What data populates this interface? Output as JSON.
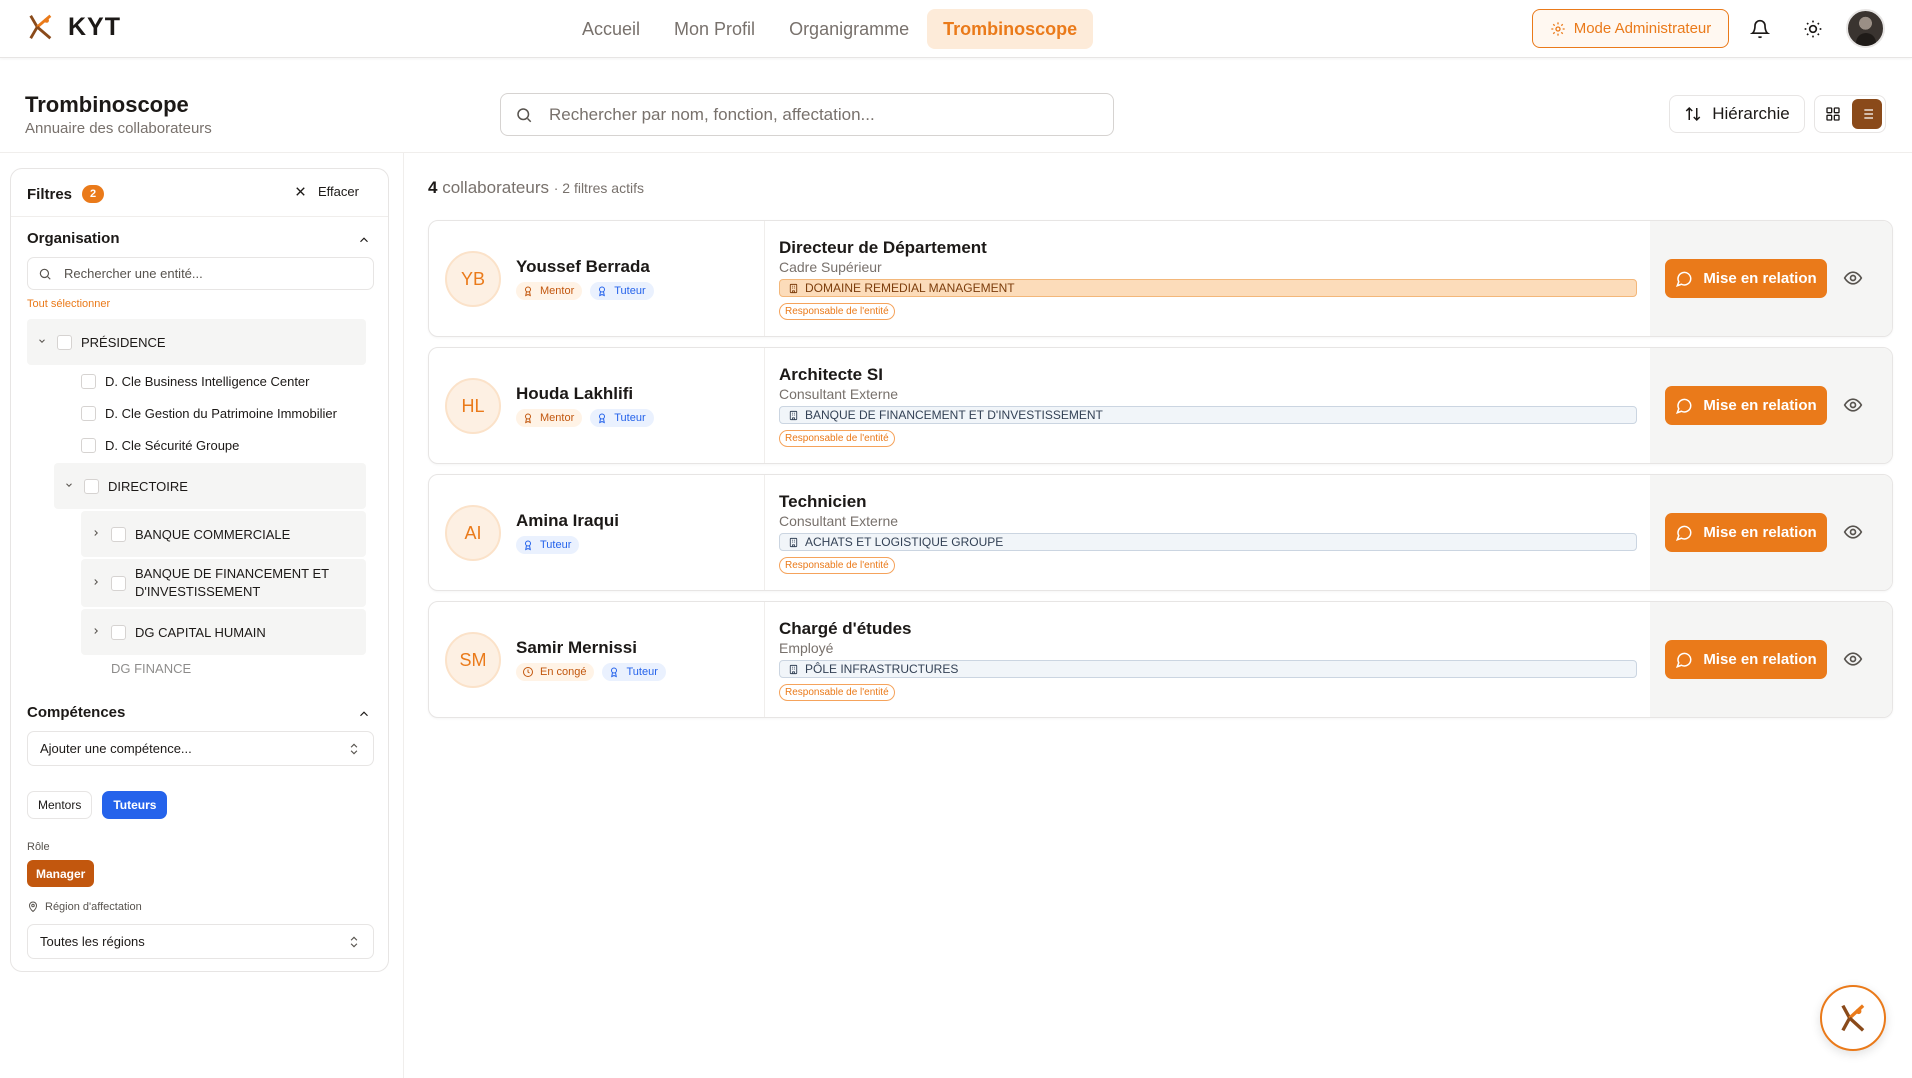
{
  "app": {
    "name": "KYT"
  },
  "nav": {
    "items": [
      {
        "label": "Accueil",
        "active": false
      },
      {
        "label": "Mon Profil",
        "active": false
      },
      {
        "label": "Organigramme",
        "active": false
      },
      {
        "label": "Trombinoscope",
        "active": true
      }
    ]
  },
  "topbar": {
    "admin_label": "Mode Administrateur"
  },
  "page": {
    "title": "Trombinoscope",
    "subtitle": "Annuaire des collaborateurs",
    "search_placeholder": "Rechercher par nom, fonction, affectation...",
    "hierarchy_label": "Hiérarchie"
  },
  "filters": {
    "title": "Filtres",
    "count": "2",
    "clear_label": "Effacer",
    "organisation": {
      "title": "Organisation",
      "search_placeholder": "Rechercher une entité...",
      "select_all": "Tout sélectionner",
      "tree": [
        "PRÉSIDENCE",
        "D. Cle Business Intelligence Center",
        "D. Cle Gestion du Patrimoine Immobilier",
        "D. Cle Sécurité Groupe",
        "DIRECTOIRE",
        "BANQUE COMMERCIALE",
        "BANQUE DE FINANCEMENT ET",
        "D'INVESTISSEMENT",
        "DG CAPITAL HUMAIN",
        "DG FINANCE"
      ]
    },
    "competences": {
      "title": "Compétences",
      "select_placeholder": "Ajouter une compétence...",
      "pills": [
        "Mentors",
        "Tuteurs"
      ]
    },
    "role": {
      "label": "Rôle",
      "value": "Manager"
    },
    "region": {
      "label": "Région d'affectation",
      "value": "Toutes les régions"
    }
  },
  "results": {
    "count": "4",
    "count_label": "collaborateurs",
    "active_filters": "· 2 filtres actifs",
    "contact_label": "Mise en relation",
    "responsable_label": "Responsable de l'entité",
    "cards": [
      {
        "initials": "YB",
        "name": "Youssef Berrada",
        "badges": [
          "Mentor",
          "Tuteur"
        ],
        "role": "Directeur de Département",
        "grade": "Cadre Supérieur",
        "entity": "DOMAINE REMEDIAL MANAGEMENT"
      },
      {
        "initials": "HL",
        "name": "Houda Lakhlifi",
        "badges": [
          "Mentor",
          "Tuteur"
        ],
        "role": "Architecte SI",
        "grade": "Consultant Externe",
        "entity": "BANQUE DE FINANCEMENT ET D'INVESTISSEMENT"
      },
      {
        "initials": "AI",
        "name": "Amina Iraqui",
        "badges": [
          "Tuteur"
        ],
        "role": "Technicien",
        "grade": "Consultant Externe",
        "entity": "ACHATS ET LOGISTIQUE GROUPE"
      },
      {
        "initials": "SM",
        "name": "Samir Mernissi",
        "badges": [
          "En congé",
          "Tuteur"
        ],
        "role": "Chargé d'études",
        "grade": "Employé",
        "entity": "PÔLE INFRASTRUCTURES"
      }
    ]
  },
  "colors": {
    "accent": "#ea7a1a",
    "accent_dark": "#c2570e",
    "blue": "#2563eb"
  }
}
